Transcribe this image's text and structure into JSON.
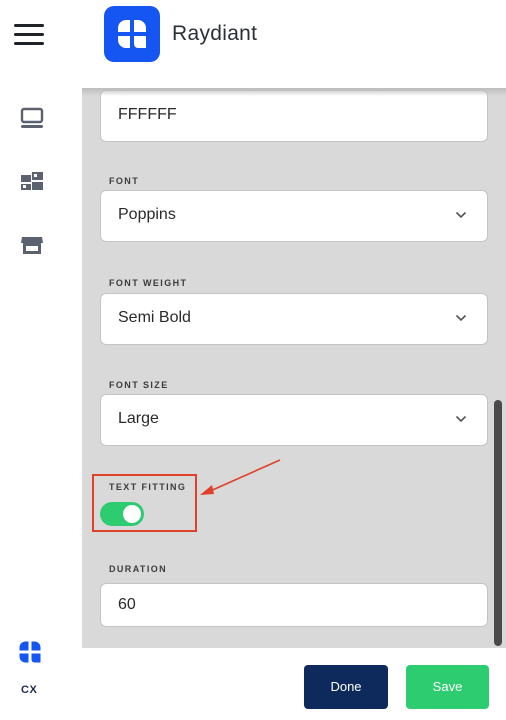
{
  "header": {
    "brand_name": "Raydiant"
  },
  "sidebar": {
    "items": [
      {
        "icon": "monitor-icon"
      },
      {
        "icon": "media-library-icon"
      },
      {
        "icon": "store-icon"
      }
    ],
    "account_label": "CX"
  },
  "form": {
    "color_value": "FFFFFF",
    "font": {
      "label": "FONT",
      "value": "Poppins"
    },
    "font_weight": {
      "label": "FONT WEIGHT",
      "value": "Semi Bold"
    },
    "font_size": {
      "label": "FONT SIZE",
      "value": "Large"
    },
    "text_fitting": {
      "label": "TEXT FITTING",
      "enabled": true
    },
    "duration": {
      "label": "DURATION",
      "value": "60"
    }
  },
  "footer": {
    "done_label": "Done",
    "save_label": "Save"
  },
  "colors": {
    "brand_blue": "#1556f2",
    "toggle_on": "#2ecc71",
    "done_button": "#0e2a5c",
    "save_button": "#2ecc71",
    "annotation": "#e0412b"
  }
}
